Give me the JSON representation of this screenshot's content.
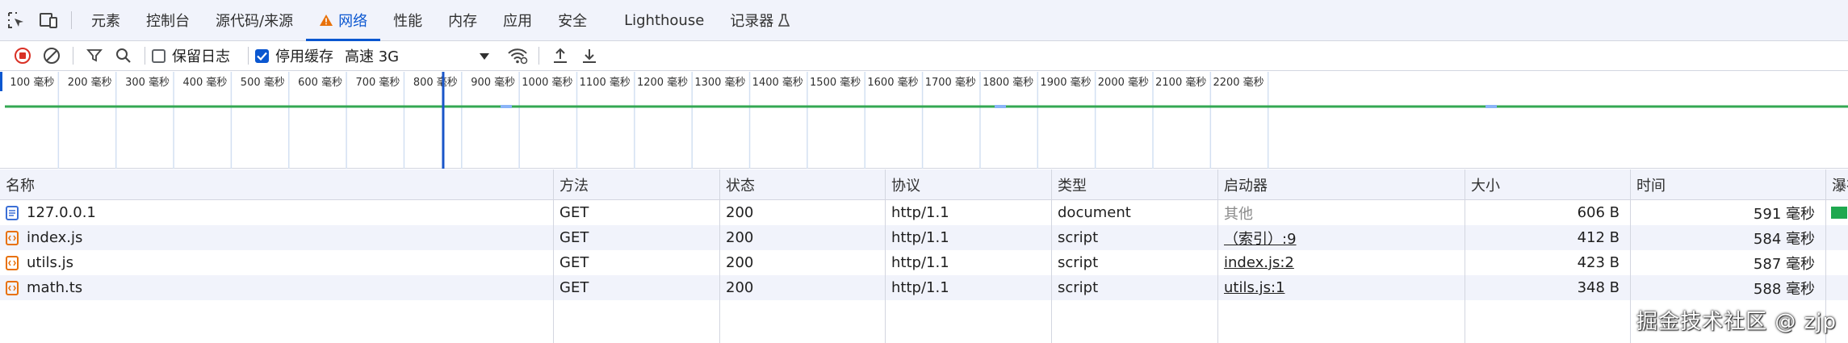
{
  "tabs": [
    {
      "label": "元素",
      "active": false
    },
    {
      "label": "控制台",
      "active": false
    },
    {
      "label": "源代码/来源",
      "active": false
    },
    {
      "label": "网络",
      "active": true
    },
    {
      "label": "性能",
      "active": false
    },
    {
      "label": "内存",
      "active": false
    },
    {
      "label": "应用",
      "active": false
    },
    {
      "label": "安全",
      "active": false
    },
    {
      "label": "Lighthouse",
      "active": false
    },
    {
      "label": "记录器",
      "active": false
    }
  ],
  "toolbar": {
    "preserve_log": {
      "label": "保留日志",
      "checked": false
    },
    "disable_cache": {
      "label": "停用缓存",
      "checked": true
    },
    "throttle_value": "高速 3G"
  },
  "timeline": {
    "ticks": [
      "100 毫秒",
      "200 毫秒",
      "300 毫秒",
      "400 毫秒",
      "500 毫秒",
      "600 毫秒",
      "700 毫秒",
      "800 毫秒",
      "900 毫秒",
      "1000 毫秒",
      "1100 毫秒",
      "1200 毫秒",
      "1300 毫秒",
      "1400 毫秒",
      "1500 毫秒",
      "1600 毫秒",
      "1700 毫秒",
      "1800 毫秒",
      "1900 毫秒",
      "2000 毫秒",
      "2100 毫秒",
      "2200 毫秒"
    ],
    "dom_content_loaded_ms": 768
  },
  "columns": [
    "名称",
    "方法",
    "状态",
    "协议",
    "类型",
    "启动器",
    "大小",
    "时间",
    "瀑布"
  ],
  "rows": [
    {
      "name": "127.0.0.1",
      "icon": "document-icon",
      "method": "GET",
      "status": "200",
      "protocol": "http/1.1",
      "type": "document",
      "initiator": "其他",
      "initiator_link": false,
      "size": "606 B",
      "time": "591 毫秒"
    },
    {
      "name": "index.js",
      "icon": "script-icon",
      "method": "GET",
      "status": "200",
      "protocol": "http/1.1",
      "type": "script",
      "initiator": "（索引）:9",
      "initiator_link": true,
      "size": "412 B",
      "time": "584 毫秒"
    },
    {
      "name": "utils.js",
      "icon": "script-icon",
      "method": "GET",
      "status": "200",
      "protocol": "http/1.1",
      "type": "script",
      "initiator": "index.js:2",
      "initiator_link": true,
      "size": "423 B",
      "time": "587 毫秒"
    },
    {
      "name": "math.ts",
      "icon": "script-icon",
      "method": "GET",
      "status": "200",
      "protocol": "http/1.1",
      "type": "script",
      "initiator": "utils.js:1",
      "initiator_link": true,
      "size": "348 B",
      "time": "588 毫秒"
    }
  ],
  "watermark": "掘金技术社区 @ zjp",
  "colors": {
    "accent": "#0b57d0",
    "record": "#d93025",
    "waterfall": "#1fa84f",
    "script_icon": "#e8710a"
  }
}
